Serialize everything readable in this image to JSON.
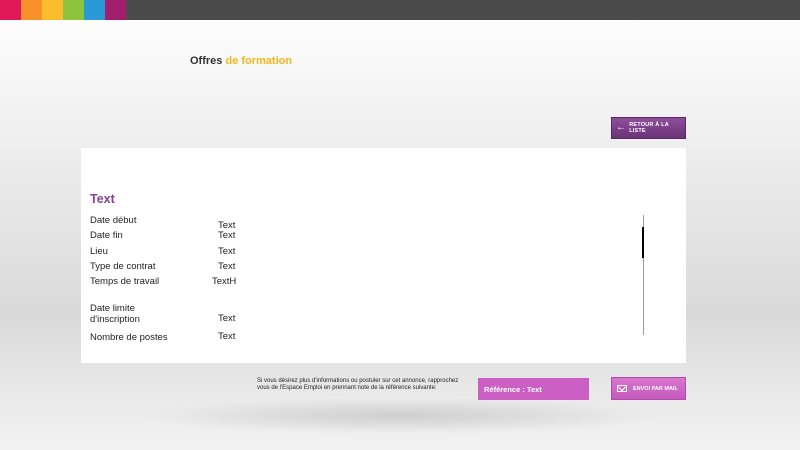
{
  "topbar": {
    "swatches": [
      "#e0195a",
      "#f7922a",
      "#fbbd2c",
      "#8cc43e",
      "#2a9ad6",
      "#a31e6d"
    ]
  },
  "header": {
    "title_part1": "Offres",
    "title_part2": "de formation"
  },
  "back_button": {
    "label": "RETOUR À LA LISTE",
    "icon": "arrow-left-icon"
  },
  "detail": {
    "title": "Text",
    "fields": [
      {
        "label": "Date début",
        "value": "Text"
      },
      {
        "label": "Date fin",
        "value": "Text"
      },
      {
        "label": "Lieu",
        "value": "Text"
      },
      {
        "label": "Type de contrat",
        "value": "Text"
      },
      {
        "label": "Temps de travail",
        "value": "TextH"
      },
      {
        "label_line1": "Date limite",
        "label_line2": "d'inscription",
        "value": "Text"
      },
      {
        "label": "Nombre de postes",
        "value": "Text"
      }
    ]
  },
  "footer": {
    "info_text": "Si vous désirez plus d'informations ou postuler sur cet annonce, rapprochez vous de l'Espace Emploi en prennant note de la référence suivante:",
    "reference": "Référence : Text",
    "mail_button": {
      "label": "ENVOI PAR MAIL",
      "icon": "envelope-icon"
    }
  },
  "colors": {
    "accent_yellow": "#f3b51c",
    "accent_purple": "#8a3f96",
    "accent_pink": "#cc5fc4"
  }
}
